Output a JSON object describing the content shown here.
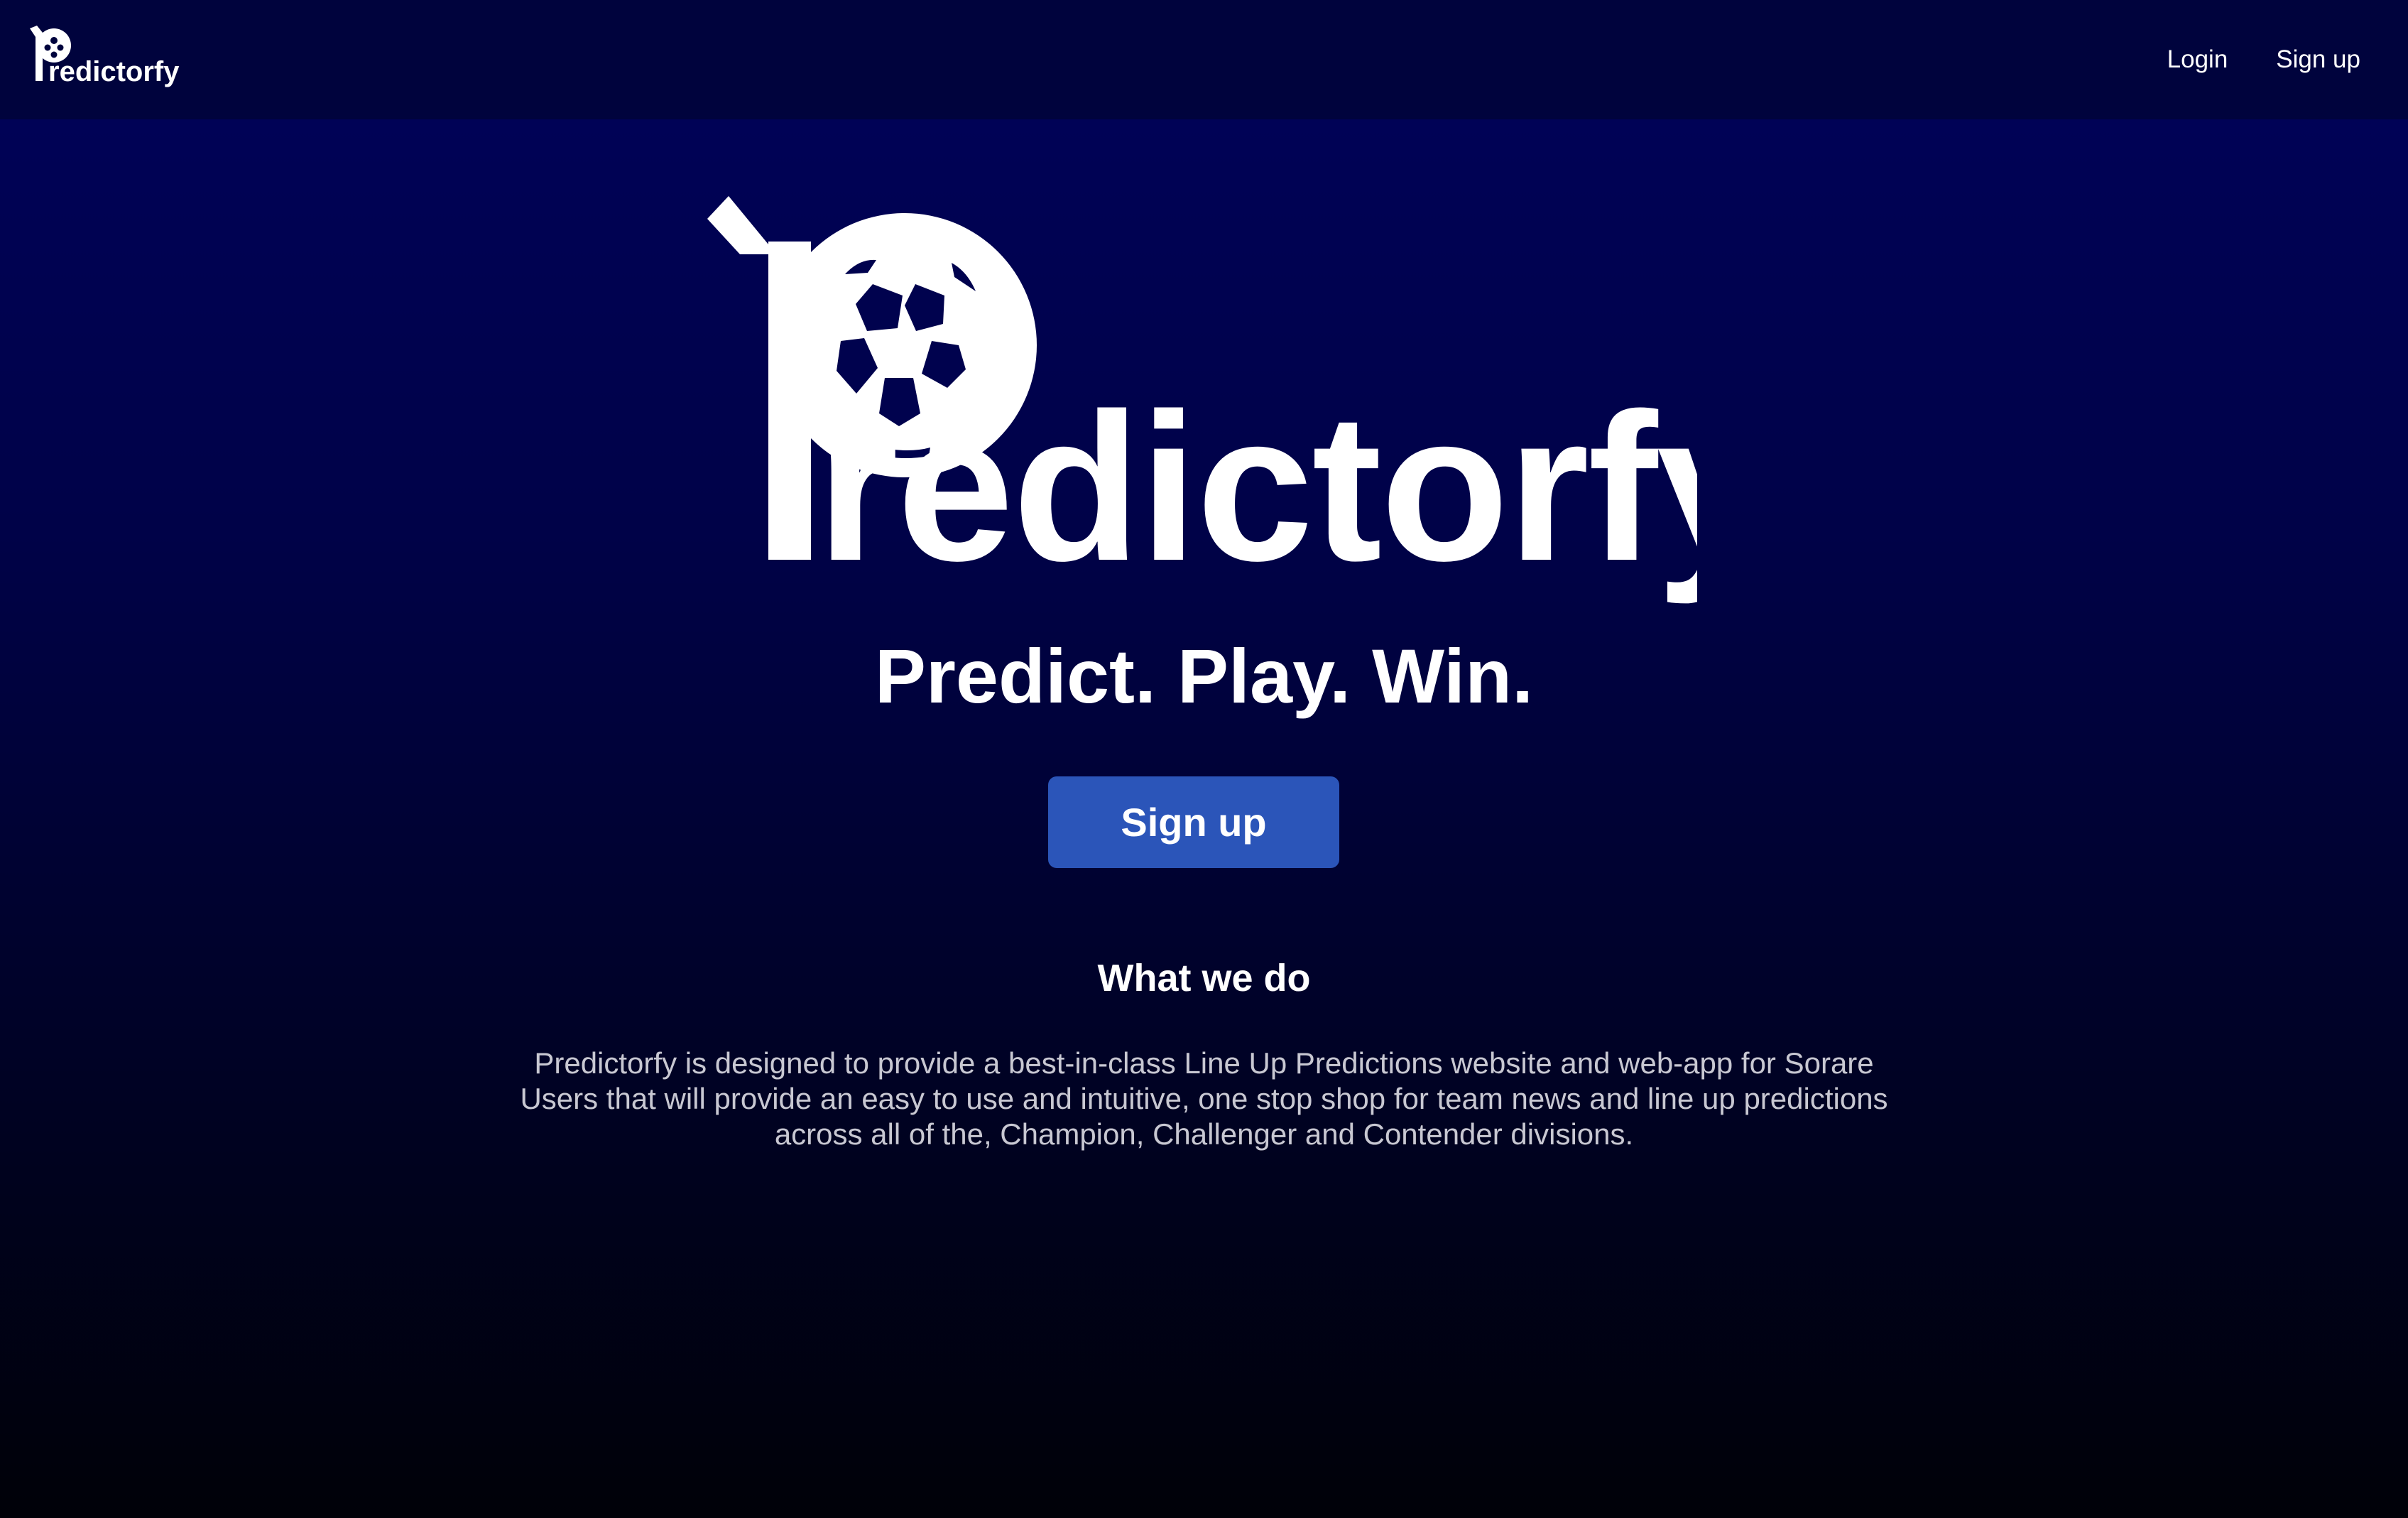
{
  "brand": {
    "name": "Predictorfy",
    "logo_wordmark": "redictorfy",
    "icon": "soccer-ball-icon"
  },
  "nav": {
    "login_label": "Login",
    "signup_label": "Sign up"
  },
  "hero": {
    "tagline": "Predict. Play. Win.",
    "cta_label": "Sign up"
  },
  "about": {
    "title": "What we do",
    "body": "Predictorfy is designed to provide a best-in-class Line Up Predictions website and web-app for Sorare Users that will provide an easy to use and intuitive, one stop shop for team news and line up predictions across all of the, Champion, Challenger and Contender divisions."
  },
  "colors": {
    "nav_background": "#00033d",
    "background_top": "#00025a",
    "background_bottom": "#000108",
    "button": "#2b55b9",
    "text": "#ffffff",
    "body_text": "#c8c8d2"
  }
}
